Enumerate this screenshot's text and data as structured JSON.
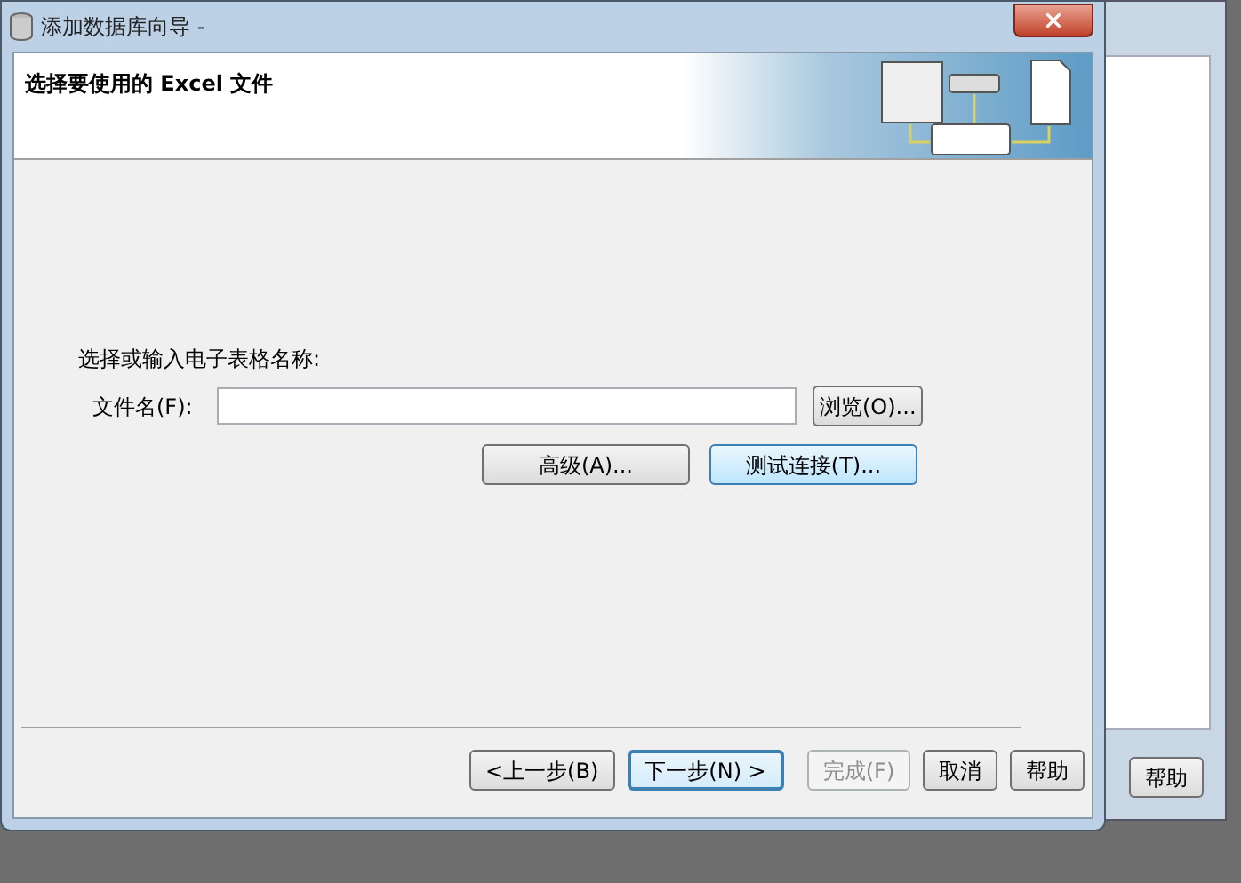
{
  "background_window": {
    "button": "帮助"
  },
  "window": {
    "title": "添加数据库向导 -"
  },
  "header": {
    "title": "选择要使用的 Excel 文件"
  },
  "form": {
    "prompt": "选择或输入电子表格名称:",
    "file_label": "文件名(F):",
    "browse_button": "浏览(O)...",
    "actions": [
      {
        "label": "高级(A)...",
        "highlighted": false
      },
      {
        "label": "测试连接(T)...",
        "highlighted": true
      }
    ]
  },
  "nav_buttons": [
    {
      "label": "<上一步(B)",
      "default": false,
      "disabled": false
    },
    {
      "label": "下一步(N) >",
      "default": true,
      "disabled": false
    },
    {
      "label": "完成(F)",
      "default": false,
      "disabled": true
    },
    {
      "label": "取消",
      "default": false,
      "disabled": false
    },
    {
      "label": "帮助",
      "default": false,
      "disabled": false
    }
  ]
}
